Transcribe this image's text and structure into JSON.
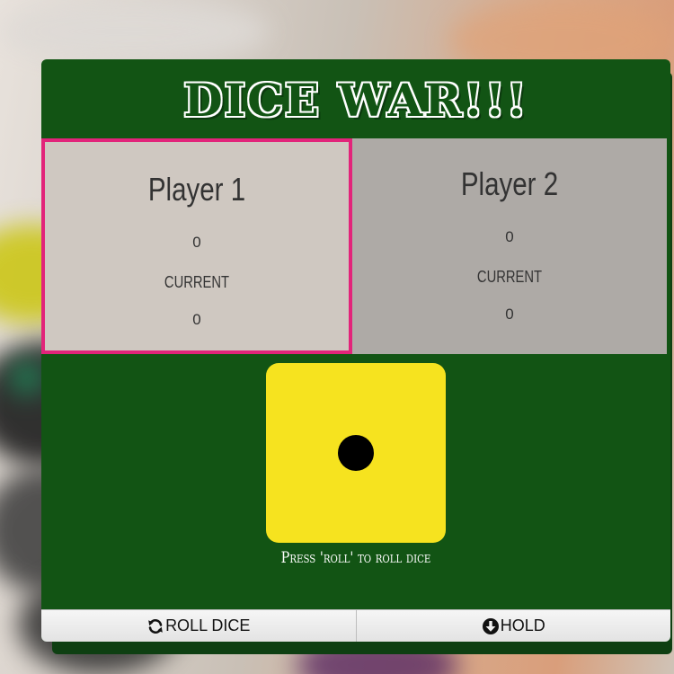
{
  "game": {
    "title": "DICE WAR!!!",
    "active_player": 1,
    "hint": "Press 'roll' to roll dice"
  },
  "players": [
    {
      "name": "Player 1",
      "score": "0",
      "current_label": "CURRENT",
      "current": "0"
    },
    {
      "name": "Player 2",
      "score": "0",
      "current_label": "CURRENT",
      "current": "0"
    }
  ],
  "die": {
    "value": 1
  },
  "buttons": {
    "roll_label": "ROLL DICE",
    "roll_icon": "refresh-icon",
    "hold_label": "HOLD",
    "hold_icon": "arrow-circle-down-icon"
  },
  "colors": {
    "board_green": "#125414",
    "active_border": "#e2247a",
    "die_yellow": "#f6e31f",
    "panel_active": "#cfc8c1",
    "panel_inactive": "#aeaaa6"
  }
}
